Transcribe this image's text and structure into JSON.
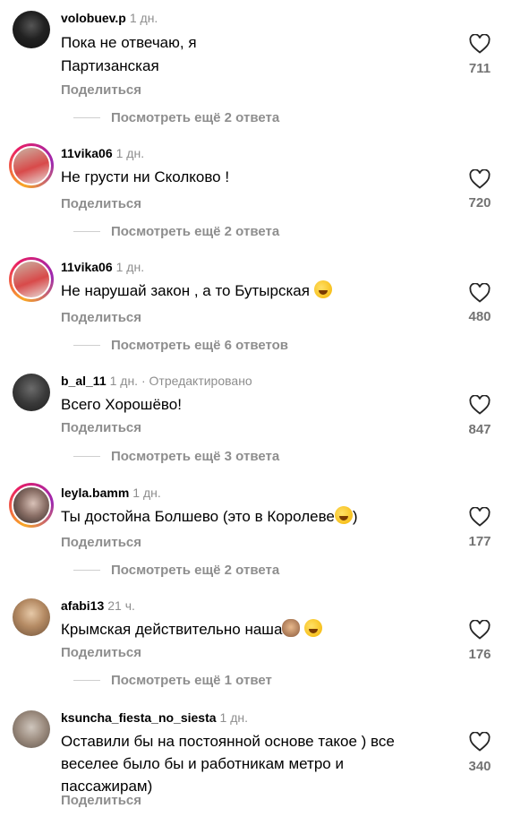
{
  "comments": [
    {
      "user": "volobuev.p",
      "time": "1 дн.",
      "edited": "",
      "text": "Пока не отвечаю, я Партизанская",
      "likes": "711",
      "share": "Поделиться",
      "replies": "Посмотреть ещё 2 ответа"
    },
    {
      "user": "11vika06",
      "time": "1 дн.",
      "edited": "",
      "text": "Не грусти ни Сколково !",
      "likes": "720",
      "share": "Поделиться",
      "replies": "Посмотреть ещё 2 ответа"
    },
    {
      "user": "11vika06",
      "time": "1 дн.",
      "edited": "",
      "text": "Не нарушай закон , а то  Бутырская",
      "likes": "480",
      "share": "Поделиться",
      "replies": "Посмотреть ещё 6 ответов"
    },
    {
      "user": "b_al_11",
      "time": "1 дн.",
      "edited": "· Отредактировано",
      "text": "Всего Хорошёво!",
      "likes": "847",
      "share": "Поделиться",
      "replies": "Посмотреть ещё 3 ответа"
    },
    {
      "user": "leyla.bamm",
      "time": "1 дн.",
      "edited": "",
      "text": "Ты достойна Болшево (это в Королеве",
      "text_after": ")",
      "likes": "177",
      "share": "Поделиться",
      "replies": "Посмотреть ещё 2 ответа"
    },
    {
      "user": "afabi13",
      "time": "21 ч.",
      "edited": "",
      "text": "Крымская действительно наша",
      "likes": "176",
      "share": "Поделиться",
      "replies": "Посмотреть ещё 1 ответ"
    },
    {
      "user": "ksuncha_fiesta_no_siesta",
      "time": "1 дн.",
      "edited": "",
      "text": "Оставили бы на постоянной основе такое ) все веселее было бы и работникам метро и пассажирам)",
      "likes": "340",
      "share": "Поделиться",
      "replies": ""
    }
  ],
  "colors": {
    "muted": "#8e8e8e",
    "likes": "#737373",
    "ring_start": "#f9a825",
    "ring_end": "#9c27b0"
  },
  "icons": {
    "like": "heart-outline-icon",
    "laugh": "laughing-emoji",
    "monkey": "see-no-evil-monkey-emoji"
  }
}
